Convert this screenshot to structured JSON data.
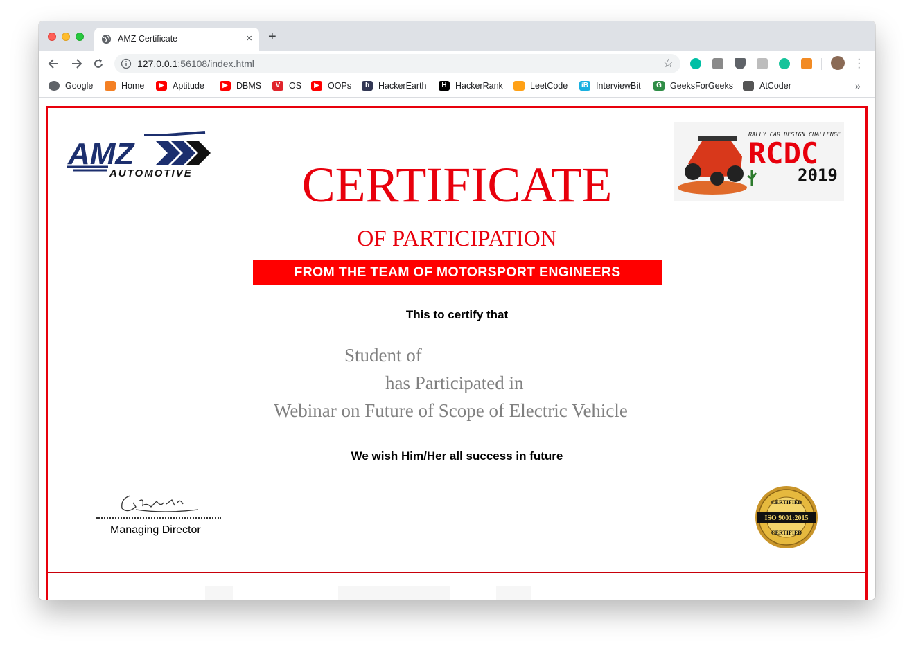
{
  "browser": {
    "tab_title": "AMZ Certificate",
    "tab_close": "×",
    "new_tab": "+",
    "url_host": "127.0.0.1",
    "url_rest": ":56108/index.html",
    "star": "☆",
    "bookmarks_more": "»",
    "bookmarks": [
      {
        "label": "Google",
        "icon": "globe-icon",
        "color": "#5f6368"
      },
      {
        "label": "Home",
        "icon": "stackoverflow-icon",
        "color": "#f48024"
      },
      {
        "label": "Aptitude",
        "icon": "youtube-icon",
        "color": "#ff0000"
      },
      {
        "label": "DBMS",
        "icon": "youtube-icon",
        "color": "#ff0000"
      },
      {
        "label": "OS",
        "icon": "vit-icon",
        "color": "#e0242b"
      },
      {
        "label": "OOPs",
        "icon": "youtube-icon",
        "color": "#ff0000"
      },
      {
        "label": "HackerEarth",
        "icon": "hackerearth-icon",
        "color": "#323754"
      },
      {
        "label": "HackerRank",
        "icon": "hackerrank-icon",
        "color": "#000000"
      },
      {
        "label": "LeetCode",
        "icon": "leetcode-icon",
        "color": "#ffa116"
      },
      {
        "label": "InterviewBit",
        "icon": "interviewbit-icon",
        "color": "#1ab0e0"
      },
      {
        "label": "GeeksForGeeks",
        "icon": "geeksforgeeks-icon",
        "color": "#2f8d46"
      },
      {
        "label": "AtCoder",
        "icon": "atcoder-icon",
        "color": "#555555"
      }
    ]
  },
  "certificate": {
    "logo_amz_text": "AMZ",
    "logo_amz_sub": "AUTOMOTIVE",
    "logo_rcdc_top": "RALLY CAR DESIGN CHALLENGE",
    "logo_rcdc_main": "RCDC",
    "logo_rcdc_year": "2019",
    "title": "CERTIFICATE",
    "subtitle": "OF PARTICIPATION",
    "banner": "FROM THE TEAM OF MOTORSPORT ENGINEERS",
    "certify_line": "This to certify that",
    "student_line": "Student of",
    "participated_line": "has Participated in",
    "event_line": "Webinar on Future of Scope of Electric Vehicle",
    "wish_line": "We wish Him/Her all success in future",
    "signatory": "Managing Director",
    "seal_top": "CERTIFIED",
    "seal_middle": "ISO 9001:2015",
    "seal_bottom": "CERTIFIED",
    "accent_color": "#e8000c"
  }
}
